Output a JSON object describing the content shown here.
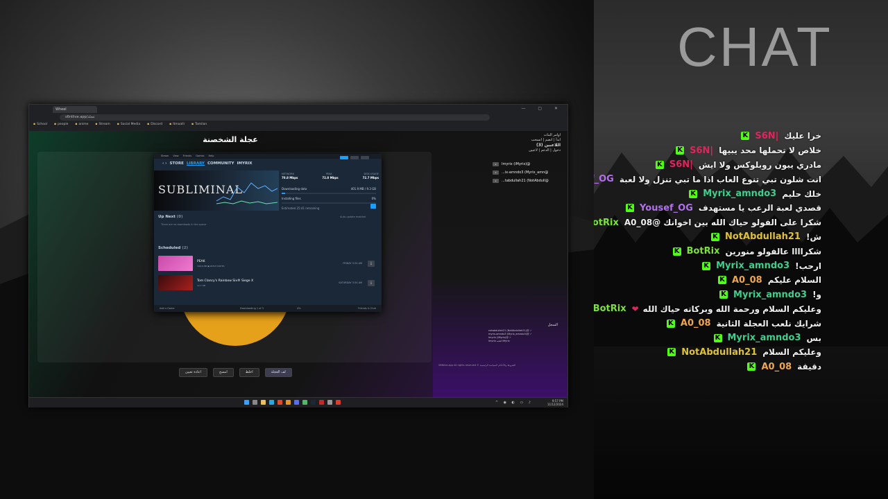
{
  "chat": {
    "title": "CHAT",
    "messages": [
      {
        "user": "S6N|",
        "text": "خرا عليك",
        "color": "#e0245e",
        "heart": false
      },
      {
        "user": "S6N|",
        "text": "خلاص لا تحملها محد يبيها",
        "color": "#e0245e",
        "heart": false
      },
      {
        "user": "S6N|",
        "text": "مادري يبون روبلوكس ولا ايش",
        "color": "#e0245e",
        "heart": false
      },
      {
        "user": "Yousef_OG",
        "text": "انت شلون تبي تنوع العاب اذا ما تبي تنزل ولا لعبة",
        "color": "#b46ff0",
        "heart": false
      },
      {
        "user": "Myrix_amndo3",
        "text": "خلك حليم",
        "color": "#3ecf8e",
        "heart": false
      },
      {
        "user": "Yousef_OG",
        "text": "قصدي لعبة الرعب يا مستهدف",
        "color": "#b46ff0",
        "heart": false
      },
      {
        "user": "BotRix",
        "text": "شكرا على الفولو حياك الله بين اخوانك @A0_08",
        "color": "#7ee03b",
        "heart": false
      },
      {
        "user": "NotAbdullah21",
        "text": "ش!",
        "color": "#e0c23a",
        "heart": false
      },
      {
        "user": "BotRix",
        "text": "شكراااا عالفولو منورين",
        "color": "#7ee03b",
        "heart": false
      },
      {
        "user": "Myrix_amndo3",
        "text": "ارحب!",
        "color": "#3ecf8e",
        "heart": false
      },
      {
        "user": "A0_08",
        "text": "السلام عليكم",
        "color": "#f0a64a",
        "heart": false
      },
      {
        "user": "Myrix_amndo3",
        "text": "و!",
        "color": "#3ecf8e",
        "heart": false
      },
      {
        "user": "BotRix",
        "text": "وعليكم السلام ورحمة الله وبركاته حياك الله",
        "color": "#7ee03b",
        "heart": true
      },
      {
        "user": "A0_08",
        "text": "شرايك نلعب العجلة الثانية",
        "color": "#f0a64a",
        "heart": false
      },
      {
        "user": "Myrix_amndo3",
        "text": "بس",
        "color": "#3ecf8e",
        "heart": false
      },
      {
        "user": "NotAbdullah21",
        "text": "وعليكم السلام",
        "color": "#e0c23a",
        "heart": false
      },
      {
        "user": "A0_08",
        "text": "دقيقة",
        "color": "#f0a64a",
        "heart": false
      }
    ]
  },
  "browser": {
    "tab": "Wheel",
    "url": "s6ntlive.app/عجلة",
    "bookmarks": [
      "School",
      "people",
      "anime",
      "Stream",
      "Social Media",
      "Discord",
      "Itmaalli",
      "Tamilan"
    ]
  },
  "page": {
    "title": "عجلة الشخصنة",
    "buttons": {
      "spin": "لف العجلة",
      "shuffle": "اخلط",
      "clear": "امسح",
      "reset": "اعادة تعيين"
    }
  },
  "side": {
    "h1": "اوامر البنات",
    "h2": "ابدأ | انضم | انسحب",
    "players_title": "اللاعبين (3)",
    "h3": "دخول | الدعم | لاعبين",
    "players": [
      "Imyrix (iMyrix)@",
      "...ix-amndo3 (Myrix_amn@",
      "...tabdullah21 (NotAbdull@"
    ],
    "log_title": "السجل",
    "log": [
      "notabdullah21 (NotAbdullah21)@ ✓",
      "myrix-amndo3 (Myrix_amndo3)@ ✓",
      "Imyrix (iMyrix)@ ✓",
      "imyrix ﺎﻀﻧﻣ iMyrix"
    ],
    "footer": "S6Nlive.app All rights reserved ©     الشروط والأحكام     السياسة الرئيسية"
  },
  "taskbar": {
    "time": "9:57 PM",
    "date": "11/12/2024"
  },
  "steam": {
    "menu": [
      "Steam",
      "View",
      "Friends",
      "Games",
      "Help"
    ],
    "nav": [
      "STORE",
      "LIBRARY",
      "COMMUNITY",
      "IMYRIX"
    ],
    "banner": "SUBLIMINAL",
    "stats": {
      "network_label": "NETWORK",
      "network": "70.8 Mbps",
      "peak_label": "PEAK",
      "peak": "72.8 Mbps",
      "disk_label": "DISK USAGE",
      "disk": "72.7 Mbps"
    },
    "downloading_label": "Downloading data",
    "downloading_value": "401.9 MB / 9.3 GB",
    "downloading_fraction": 0.04,
    "installing_label": "Installing files",
    "installing_value": "0%",
    "estimated": "Estimated 25:41 remaining",
    "up_next": "Up Next",
    "up_next_count": "(0)",
    "auto_update": "Auto-update enabled",
    "queue_empty": "There are no downloads in the queue",
    "scheduled": "Scheduled",
    "scheduled_count": "(2)",
    "games": [
      {
        "name": "PEAK",
        "meta": "346.6 MB   ▣ PATCH NOTES",
        "when": "FRIDAY 3:34 AM"
      },
      {
        "name": "Tom Clancy's Rainbow Six® Siege X",
        "meta": "12.7 GB",
        "when": "SATURDAY 3:34 AM"
      }
    ],
    "footer_left": "Add a Game",
    "footer_mid": "Downloading 1 of 3",
    "footer_mid_pct": "4%",
    "footer_right": "Friends & Chat"
  }
}
